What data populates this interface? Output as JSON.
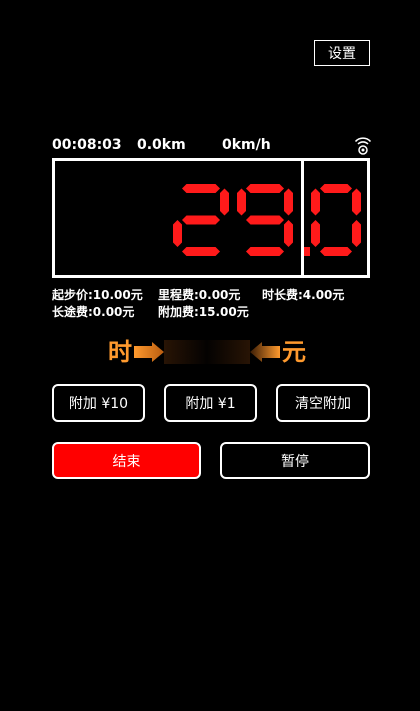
{
  "header": {
    "settings_label": "设置"
  },
  "status": {
    "elapsed": "00:08:03",
    "distance": "0.0km",
    "speed": "0km/h",
    "signal_icon": "signal-icon"
  },
  "meter": {
    "fare_display": "29.0",
    "main_digits": "29.",
    "decimal_digit": "0",
    "digit_color": "#ff1a1a"
  },
  "fees": {
    "base": "起步价:10.00元",
    "mileage": "里程费:0.00元",
    "time": "时长费:4.00元",
    "long_distance": "长途费:0.00元",
    "extra": "附加费:15.00元"
  },
  "banner": {
    "left_char": "时",
    "right_char": "元",
    "accent": "#ff9a2e"
  },
  "buttons": {
    "add10": "附加 ¥10",
    "add1": "附加 ¥1",
    "clear": "清空附加",
    "end": "结束",
    "pause": "暂停",
    "end_color": "#ff0000"
  }
}
